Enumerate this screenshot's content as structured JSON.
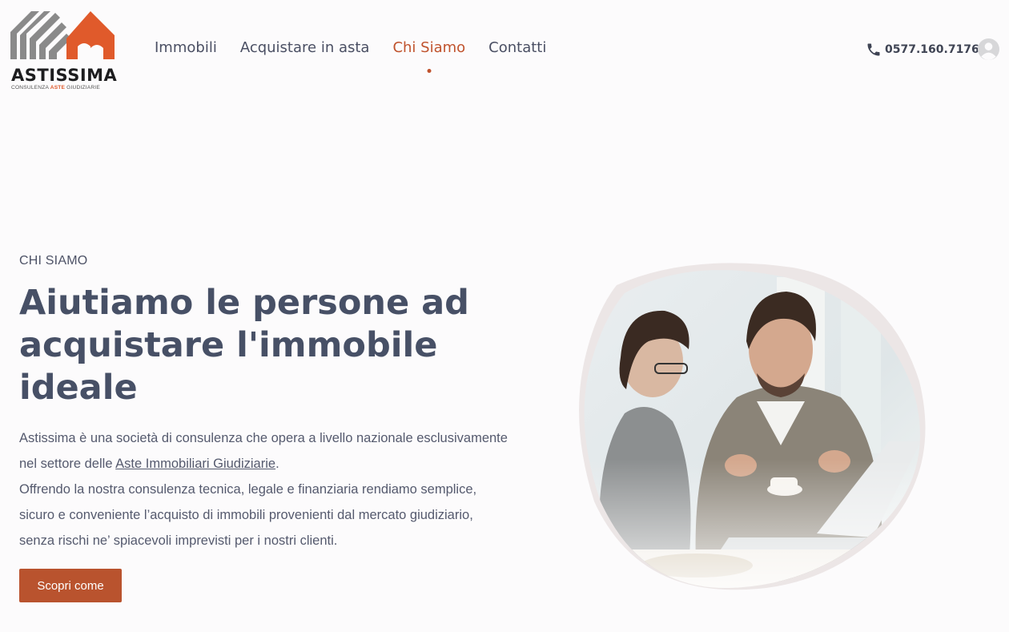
{
  "logo": {
    "brand": "ASTISSIMA",
    "tagline_pre": "CONSULENZA ",
    "tagline_accent": "ASTE",
    "tagline_post": " GIUDIZIARIE"
  },
  "nav": {
    "items": [
      {
        "label": "Immobili"
      },
      {
        "label": "Acquistare in asta"
      },
      {
        "label": "Chi Siamo"
      },
      {
        "label": "Contatti"
      }
    ],
    "active_index": 2
  },
  "header": {
    "phone": "0577.160.7176",
    "phone_icon": "phone-icon",
    "user_icon": "user-avatar-icon"
  },
  "hero": {
    "eyebrow": "CHI SIAMO",
    "title_line1": "Aiutiamo le persone ad",
    "title_line2": "acquistare l'immobile",
    "title_line3": "ideale",
    "p1_before": "Astissima è una società di consulenza che opera a livello nazionale esclusivamente nel settore delle ",
    "p1_link": "Aste Immobiliari Giudiziarie",
    "p1_after": ".",
    "p2": "Offrendo la nostra consulenza tecnica, legale e finanziaria rendiamo semplice, sicuro e conveniente l’acquisto di immobili provenienti dal mercato giudiziario, senza rischi ne’ spiacevoli imprevisti per i nostri clienti.",
    "cta": "Scopri come"
  },
  "colors": {
    "accent": "#c0532d",
    "button": "#b9532e",
    "text": "#475066",
    "background": "#fcfbfc"
  }
}
